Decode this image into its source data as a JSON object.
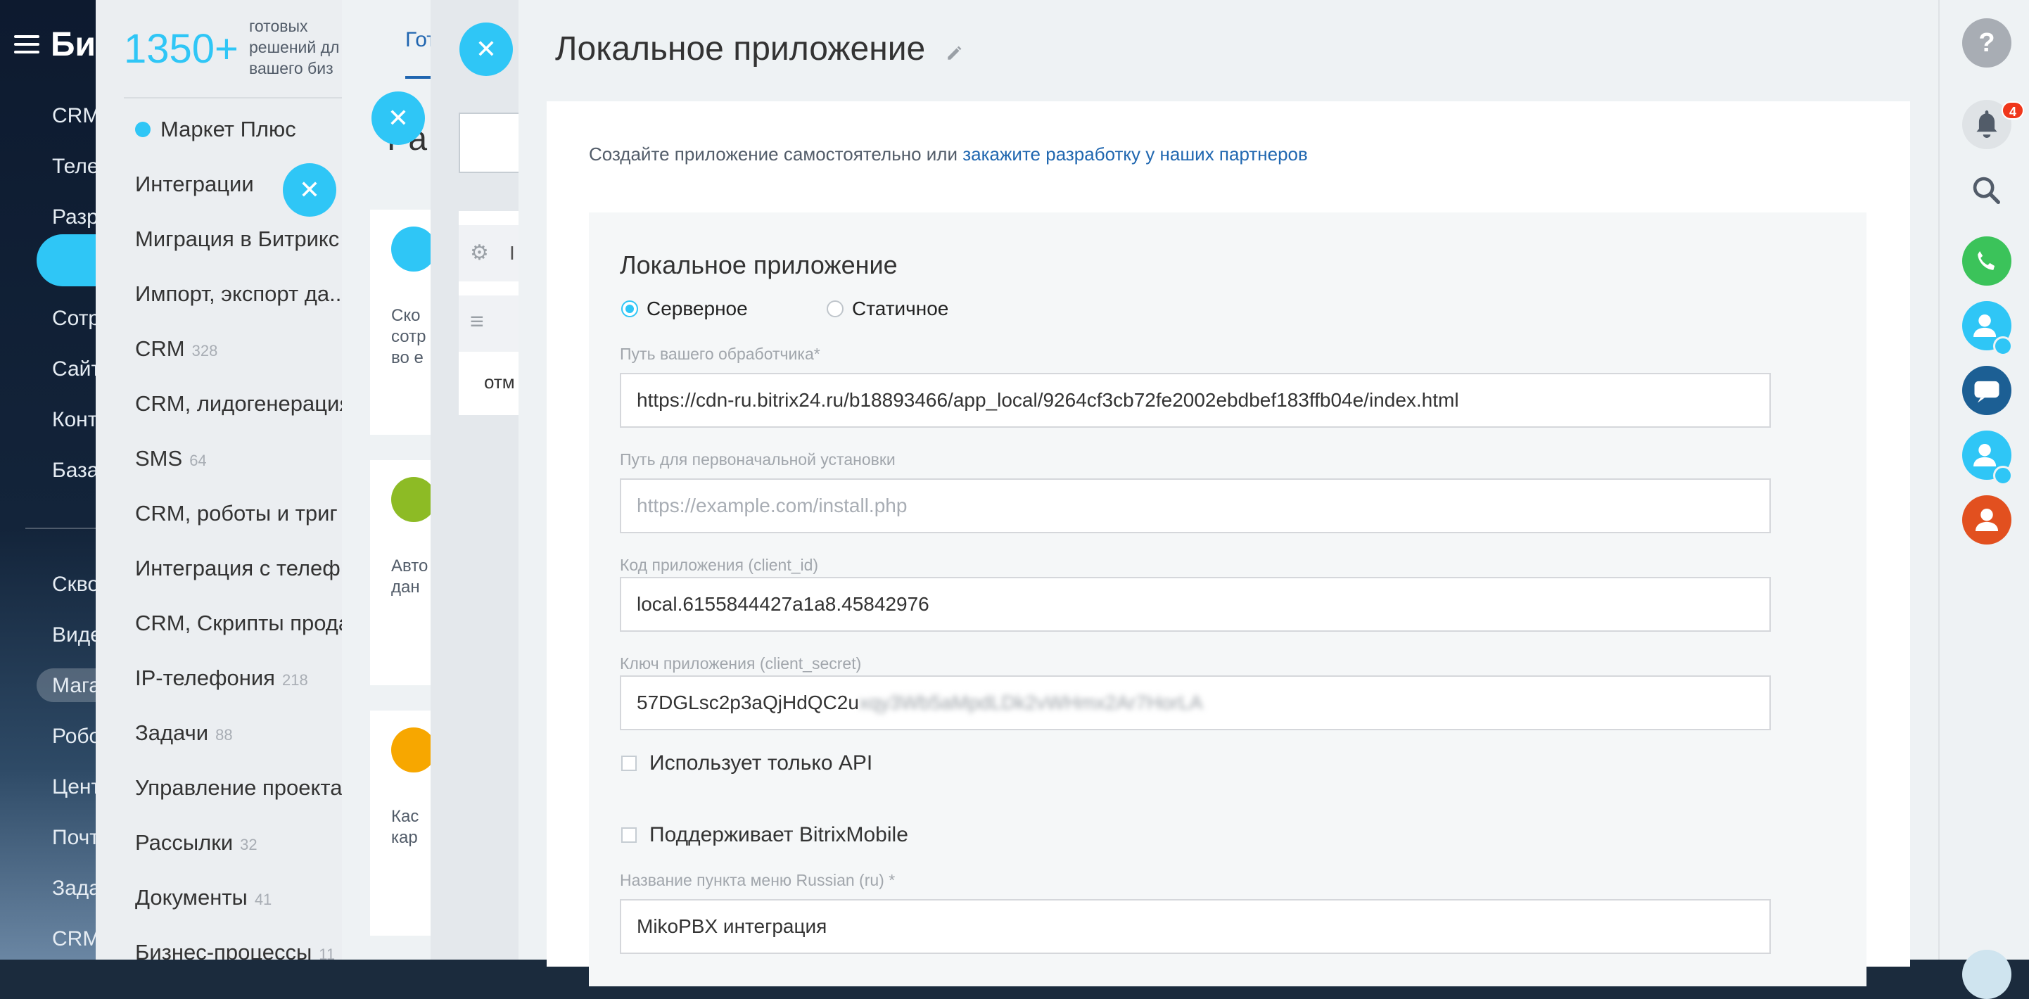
{
  "left_menu": {
    "logo": "Бит",
    "items": [
      "CRM",
      "Теле",
      "Разр",
      "Сотр",
      "Сайт",
      "Конт",
      "База",
      "Скво",
      "Виде",
      "Мага",
      "Робо",
      "Цент",
      "Почт",
      "Зада",
      "CRM"
    ]
  },
  "market_panel": {
    "count": "1350+",
    "caption": [
      "готовых",
      "решений дл",
      "вашего биз"
    ],
    "categories": [
      {
        "label": "Маркет Плюс",
        "count": ""
      },
      {
        "label": "Интеграции",
        "count": ""
      },
      {
        "label": "Миграция в Битрикс",
        "count": ""
      },
      {
        "label": "Импорт, экспорт да...",
        "count": ""
      },
      {
        "label": "CRM",
        "count": "328"
      },
      {
        "label": "CRM, лидогенерация",
        "count": ""
      },
      {
        "label": "SMS",
        "count": "64"
      },
      {
        "label": "CRM, роботы и триг",
        "count": ""
      },
      {
        "label": "Интеграция с телеф.",
        "count": ""
      },
      {
        "label": "CRM, Скрипты прода",
        "count": ""
      },
      {
        "label": "IP-телефония",
        "count": "218"
      },
      {
        "label": "Задачи",
        "count": "88"
      },
      {
        "label": "Управление проекта",
        "count": ""
      },
      {
        "label": "Рассылки",
        "count": "32"
      },
      {
        "label": "Документы",
        "count": "41"
      },
      {
        "label": "Бизнес-процессы",
        "count": "11"
      }
    ]
  },
  "dev_panel": {
    "tab": "Гот",
    "heading": "Ра",
    "card_texts": [
      [
        "Ско",
        "сотр",
        "во е"
      ],
      [
        "Авто",
        "дан"
      ],
      [
        "Кас",
        "кар"
      ]
    ]
  },
  "app_list_panel": {
    "row_text": "отм",
    "row_icon_letter": "I"
  },
  "slider": {
    "title": "Локальное приложение",
    "intro_text": "Создайте приложение самостоятельно или ",
    "intro_link": "закажите разработку у наших партнеров",
    "form": {
      "title": "Локальное приложение",
      "type_server": "Серверное",
      "type_static": "Статичное",
      "handler_label": "Путь вашего обработчика*",
      "handler_value": "https://cdn-ru.bitrix24.ru/b18893466/app_local/9264cf3cb72fe2002ebdbef183ffb04e/index.html",
      "install_label": "Путь для первоначальной установки",
      "install_placeholder": "https://example.com/install.php",
      "client_id_label": "Код приложения (client_id)",
      "client_id_value": "local.6155844427a1a8.45842976",
      "client_secret_label": "Ключ приложения (client_secret)",
      "client_secret_visible": "57DGLsc2p3aQjHdQC2u",
      "client_secret_hidden": "xqy3Wb5aMpdLDk2vWHmx2Ar7HorLA",
      "api_only_label": "Использует только API",
      "mobile_label": "Поддерживает BitrixMobile",
      "menu_name_label": "Название пункта меню Russian (ru) *",
      "menu_name_value": "MikoPBX интеграция"
    }
  },
  "right_bar": {
    "help_icon": "?",
    "notification_count": "4"
  },
  "colors": {
    "accent": "#2fc6f6",
    "link": "#2067b0",
    "badge": "#f0371b",
    "phone": "#3bc35a",
    "open_lines": "#1c5f94",
    "contact_orange": "#e2501f"
  }
}
